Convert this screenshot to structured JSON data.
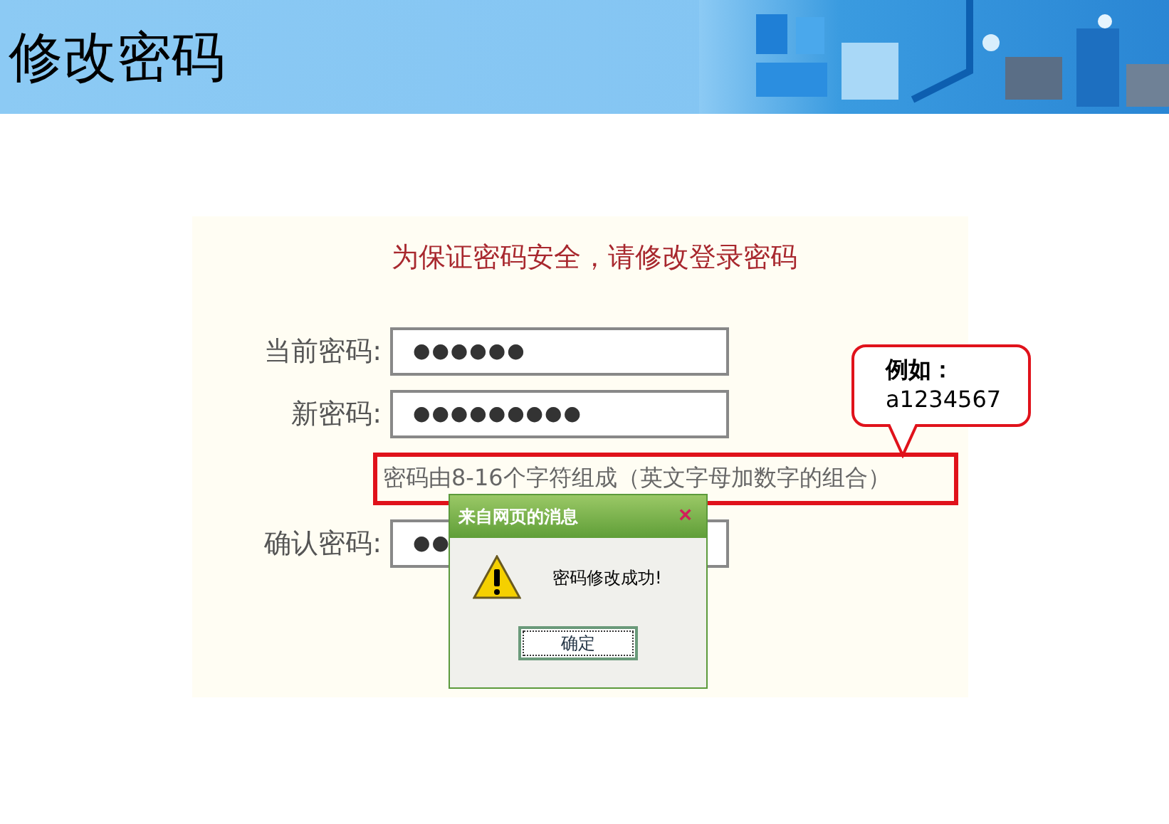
{
  "header": {
    "title": "修改密码"
  },
  "form": {
    "heading": "为保证密码安全，请修改登录密码",
    "fields": [
      {
        "label": "当前密码:",
        "value": "●●●●●●"
      },
      {
        "label": "新密码:",
        "value": "●●●●●●●●●"
      },
      {
        "label": "确认密码:",
        "value": "●●"
      }
    ],
    "hint": "密码由8-16个字符组成（英文字母加数字的组合）"
  },
  "callout": {
    "title": "例如：",
    "text": "a1234567"
  },
  "dialog": {
    "title": "来自网页的消息",
    "close": "×",
    "message": "密码修改成功!",
    "buttons": [
      "确定"
    ]
  }
}
